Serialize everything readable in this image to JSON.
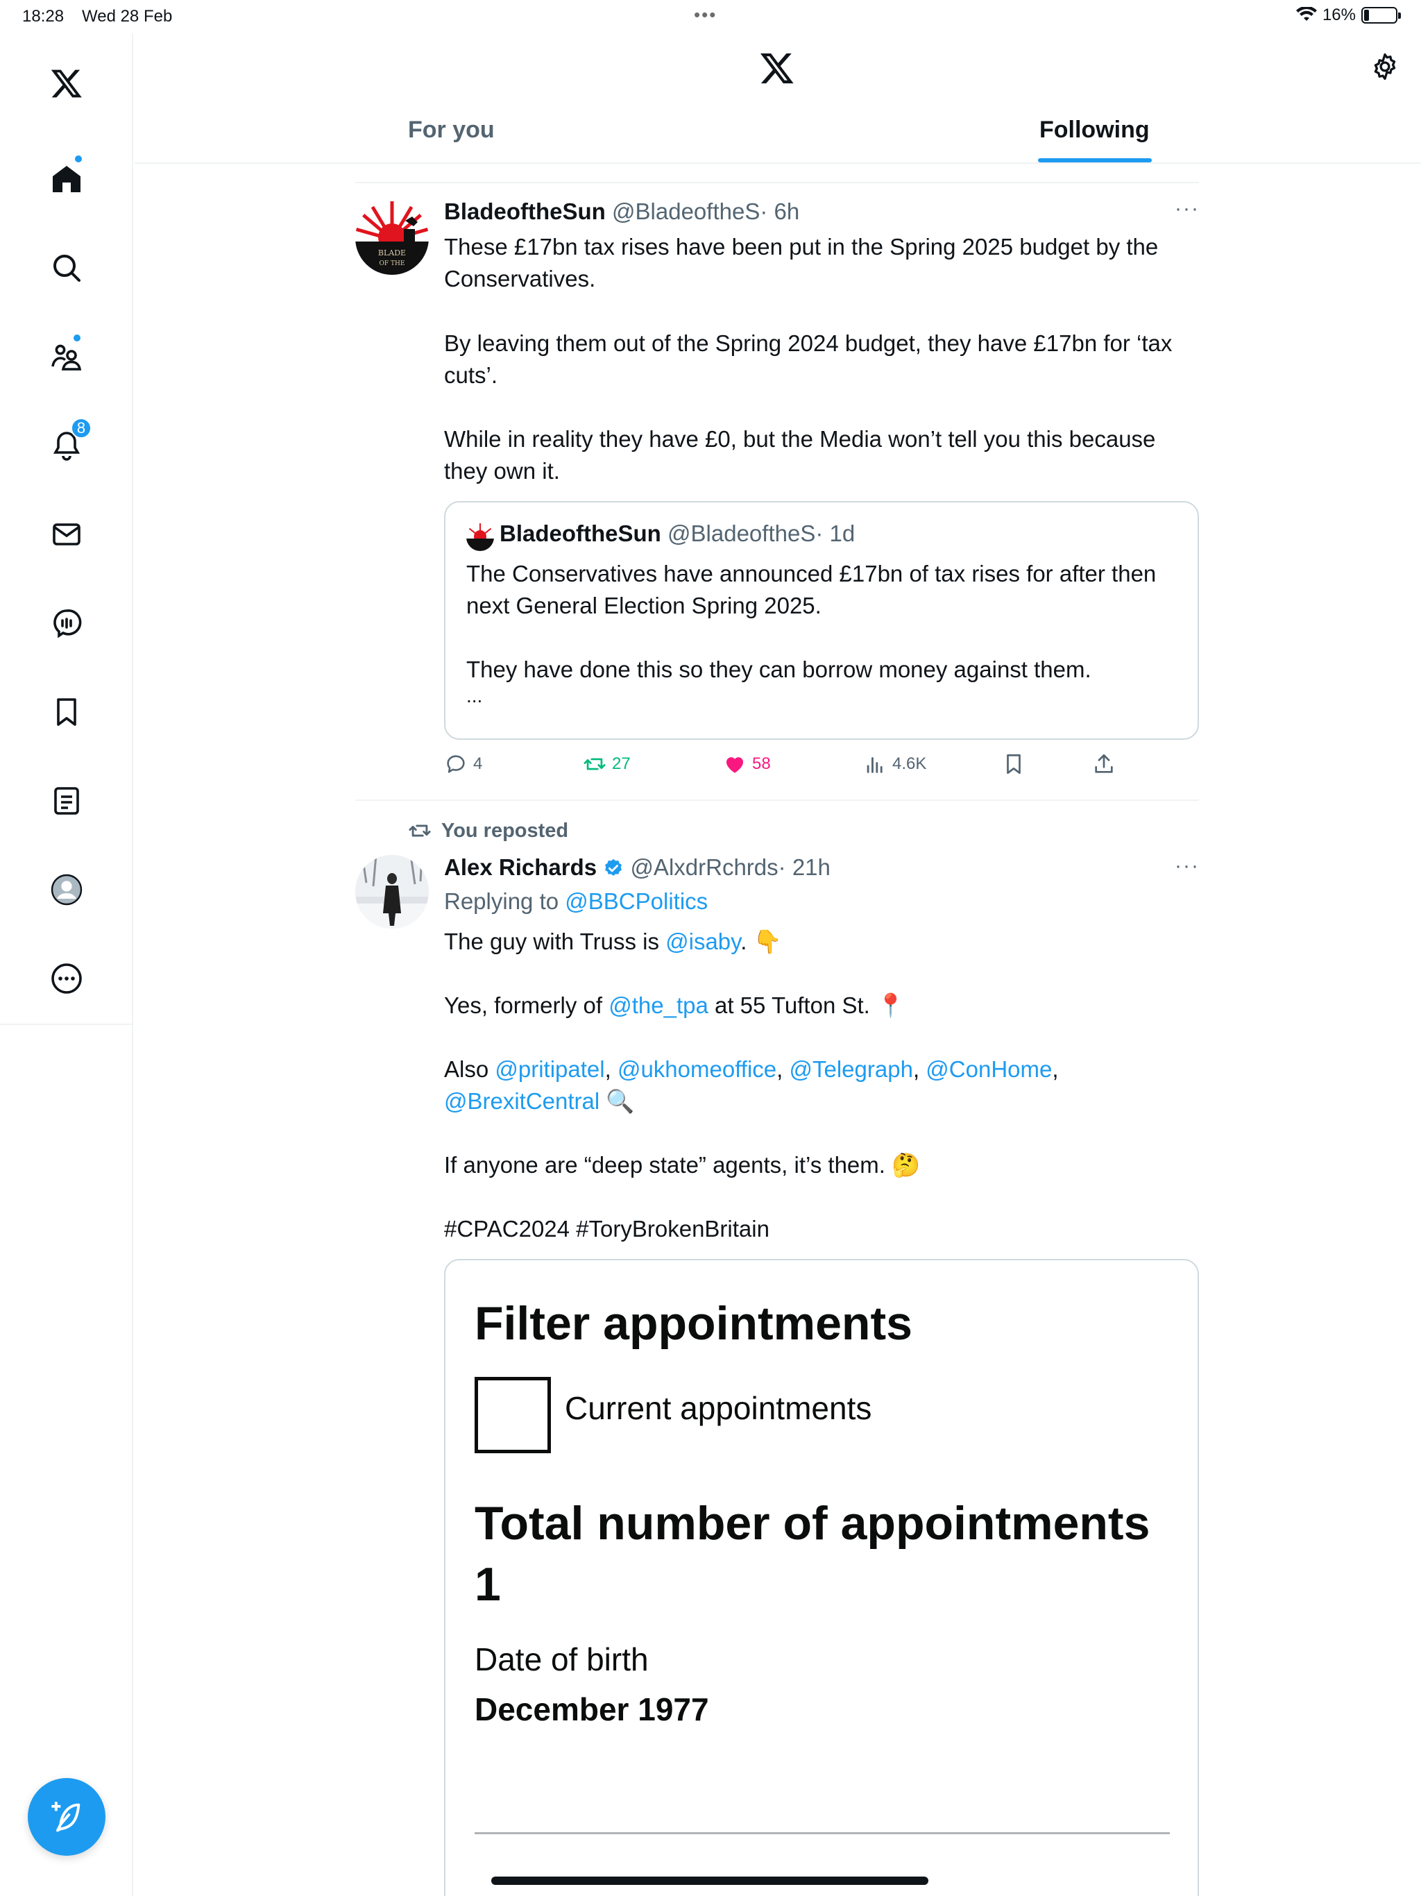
{
  "status_bar": {
    "time": "18:28",
    "date": "Wed 28 Feb",
    "battery": "16%",
    "battery_level": 0.16
  },
  "nav": {
    "notifications_badge": "8",
    "items": [
      "home-icon",
      "search-icon",
      "communities-icon",
      "notifications-icon",
      "messages-icon",
      "spaces-icon",
      "bookmarks-icon",
      "lists-icon",
      "profile-icon",
      "more-icon"
    ]
  },
  "header": {
    "tabs": [
      "For you",
      "Following"
    ],
    "active_tab": "Following"
  },
  "tweets": [
    {
      "name": "BladeoftheSun",
      "handle": "@BladeoftheS",
      "time": "· 6h",
      "lines": [
        "These £17bn tax rises have been put in the Spring 2025 budget by the",
        "Conservatives.",
        "By leaving them out of the Spring 2024 budget, they have £17bn for ‘tax",
        "cuts’.",
        "While in reality they have £0, but the Media won’t tell you this because",
        "they own it."
      ],
      "quote": {
        "name": "BladeoftheSun",
        "handle": "@BladeoftheS",
        "time": "· 1d",
        "lines": [
          "The Conservatives have announced £17bn of tax rises for after then",
          "next General Election Spring 2025.",
          "They have done this so they can borrow money against them.",
          "..."
        ]
      },
      "actions": {
        "replies": "4",
        "reposts": "27",
        "likes": "58",
        "views": "4.6K"
      }
    },
    {
      "repost_label": "You reposted",
      "name": "Alex Richards",
      "handle": "@AlxdrRchrds",
      "time": "· 21h",
      "replying_prefix": "Replying to ",
      "replying_to": "@BBCPolitics",
      "l1_pre": "The guy with Truss is ",
      "l1_mention": "@isaby",
      "l1_post": ". 👇",
      "l2_pre": "Yes, formerly of ",
      "l2_mention": "@the_tpa",
      "l2_post": " at 55 Tufton St. 📍",
      "l3_pre": "Also ",
      "l3_m1": "@pritipatel",
      "l3_m2": "@ukhomeoffice",
      "l3_m3": "@Telegraph",
      "l3_m4": "@ConHome",
      "l4_m1": "@BrexitCentral",
      "l4_post": " 🔍",
      "l5": "If anyone are “deep state” agents, it’s them. 🤔",
      "hashtags": "#CPAC2024 #ToryBrokenBritain",
      "card": {
        "heading": "Filter appointments",
        "checkbox_label": "Current appointments",
        "total_heading": "Total number of appointments",
        "total_value": "1",
        "dob_label": "Date of birth",
        "dob_value": "December 1977"
      }
    }
  ],
  "colors": {
    "accent": "#1d9bf0",
    "like": "#f91880",
    "repost": "#00ba7c",
    "muted": "#536471"
  }
}
